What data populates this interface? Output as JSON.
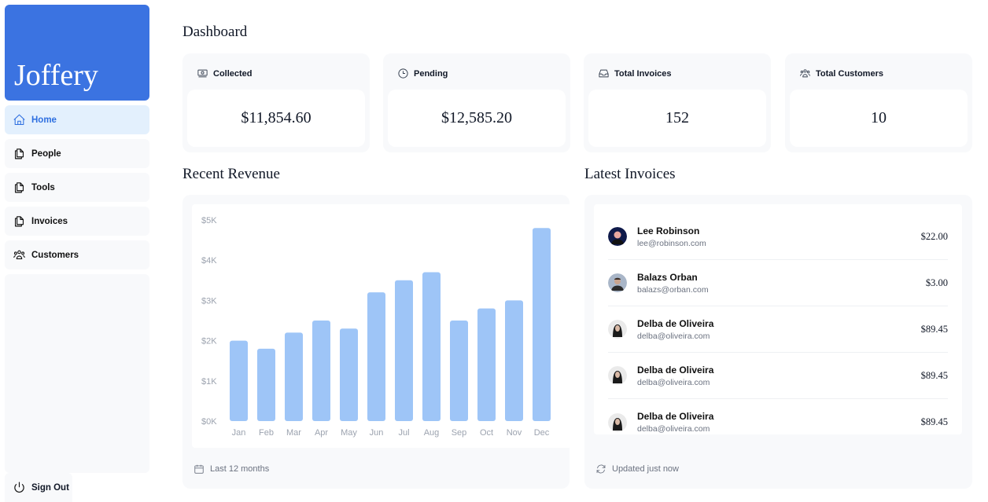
{
  "brand": {
    "name": "Joffery",
    "color": "#3b73e1"
  },
  "sidebar": {
    "items": [
      {
        "label": "Home",
        "icon": "home-icon",
        "active": true
      },
      {
        "label": "People",
        "icon": "document-duplicate-icon",
        "active": false
      },
      {
        "label": "Tools",
        "icon": "document-duplicate-icon",
        "active": false
      },
      {
        "label": "Invoices",
        "icon": "document-duplicate-icon",
        "active": false
      },
      {
        "label": "Customers",
        "icon": "user-group-icon",
        "active": false
      }
    ],
    "sign_out": "Sign Out"
  },
  "header": {
    "title": "Dashboard"
  },
  "cards": [
    {
      "label": "Collected",
      "icon": "banknotes-icon",
      "value": "$11,854.60"
    },
    {
      "label": "Pending",
      "icon": "clock-icon",
      "value": "$12,585.20"
    },
    {
      "label": "Total Invoices",
      "icon": "inbox-icon",
      "value": "152"
    },
    {
      "label": "Total Customers",
      "icon": "user-group-icon",
      "value": "10"
    }
  ],
  "revenue": {
    "title": "Recent Revenue",
    "footer": "Last 12 months"
  },
  "chart_data": {
    "type": "bar",
    "title": "Recent Revenue",
    "categories": [
      "Jan",
      "Feb",
      "Mar",
      "Apr",
      "May",
      "Jun",
      "Jul",
      "Aug",
      "Sep",
      "Oct",
      "Nov",
      "Dec"
    ],
    "values": [
      2000,
      1800,
      2200,
      2500,
      2300,
      3200,
      3500,
      3700,
      2500,
      2800,
      3000,
      4800
    ],
    "yticks": [
      "$0K",
      "$1K",
      "$2K",
      "$3K",
      "$4K",
      "$5K"
    ],
    "ylim": [
      0,
      5000
    ],
    "xlabel": "",
    "ylabel": "",
    "grid": false,
    "bar_color": "#9ec5f7"
  },
  "invoices": {
    "title": "Latest Invoices",
    "footer": "Updated just now",
    "rows": [
      {
        "name": "Lee Robinson",
        "email": "lee@robinson.com",
        "amount": "$22.00"
      },
      {
        "name": "Balazs Orban",
        "email": "balazs@orban.com",
        "amount": "$3.00"
      },
      {
        "name": "Delba de Oliveira",
        "email": "delba@oliveira.com",
        "amount": "$89.45"
      },
      {
        "name": "Delba de Oliveira",
        "email": "delba@oliveira.com",
        "amount": "$89.45"
      },
      {
        "name": "Delba de Oliveira",
        "email": "delba@oliveira.com",
        "amount": "$89.45"
      }
    ]
  }
}
